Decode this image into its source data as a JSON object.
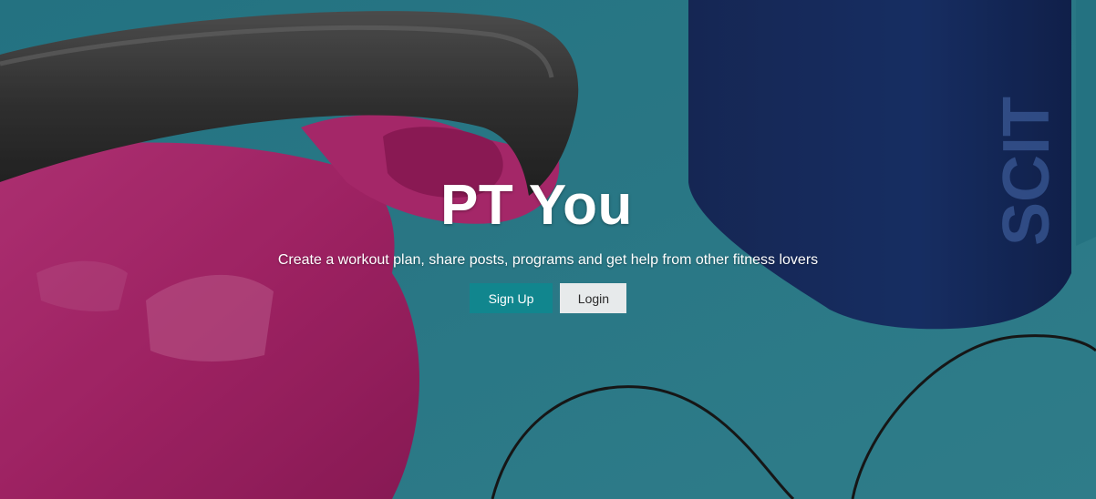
{
  "hero": {
    "title": "PT You",
    "subtitle": "Create a workout plan, share posts, programs and get help from other fitness lovers",
    "signup_label": "Sign Up",
    "login_label": "Login"
  },
  "colors": {
    "background": "#2f8fa0",
    "kettlebell": "#c42c7b",
    "bottle": "#17326f",
    "signup_button": "#11868e",
    "login_button": "#e7eaeb"
  }
}
